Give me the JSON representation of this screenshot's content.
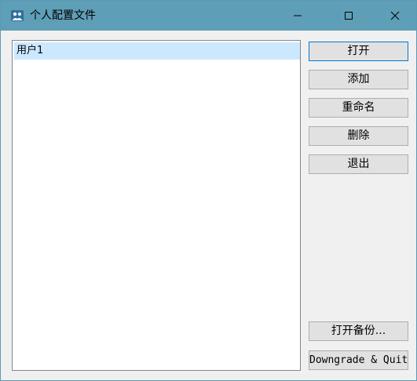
{
  "window": {
    "title": "个人配置文件"
  },
  "profiles": {
    "items": [
      "用户1"
    ],
    "selected_index": 0
  },
  "buttons": {
    "open": "打开",
    "add": "添加",
    "rename": "重命名",
    "delete": "删除",
    "exit": "退出",
    "open_backup": "打开备份...",
    "downgrade_quit": "Downgrade & Quit"
  },
  "icons": {
    "app": "app-icon",
    "minimize": "minimize-icon",
    "maximize": "maximize-icon",
    "close": "close-icon"
  },
  "colors": {
    "titlebar": "#5f9eb7",
    "selection": "#cce8ff",
    "default_button_border": "#0078d7"
  }
}
